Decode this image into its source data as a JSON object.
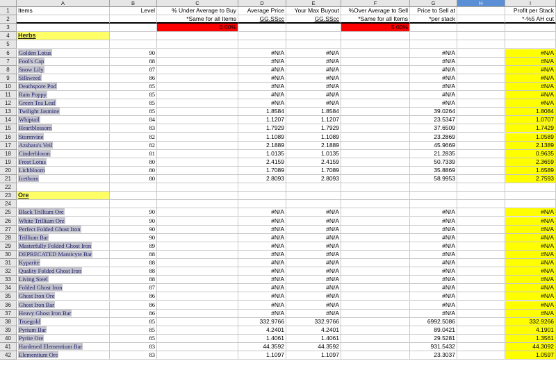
{
  "columns": [
    "A",
    "B",
    "C",
    "D",
    "E",
    "F",
    "G",
    "H",
    "I"
  ],
  "selected_column": "H",
  "header_row1": [
    "Items",
    "Level",
    "% Under Average to Buy",
    "Average Price",
    "Your Max Buyout",
    "%Over Average to Sell",
    "Price to Sell at",
    "",
    "Profit per Stack"
  ],
  "header_row2": [
    "",
    "",
    "*Same for all Items",
    "GG.SScc",
    "GG.SScc",
    "*Same for all Items",
    "*per stack",
    "",
    "*-%5 AH cut"
  ],
  "under_percent": "0.00%",
  "over_percent": "5.00%",
  "herbs_label": "Herbs",
  "ore_label": "Ore",
  "herbs": [
    {
      "name": "Golden Lotus",
      "level": "90",
      "avg": "#N/A",
      "max": "#N/A",
      "sell": "#N/A",
      "profit": "#N/A"
    },
    {
      "name": "Fool's Cap",
      "level": "88",
      "avg": "#N/A",
      "max": "#N/A",
      "sell": "#N/A",
      "profit": "#N/A"
    },
    {
      "name": "Snow Lily",
      "level": "87",
      "avg": "#N/A",
      "max": "#N/A",
      "sell": "#N/A",
      "profit": "#N/A"
    },
    {
      "name": "Silkweed",
      "level": "86",
      "avg": "#N/A",
      "max": "#N/A",
      "sell": "#N/A",
      "profit": "#N/A"
    },
    {
      "name": "Deathspore Pod",
      "level": "85",
      "avg": "#N/A",
      "max": "#N/A",
      "sell": "#N/A",
      "profit": "#N/A"
    },
    {
      "name": "Rain Poppy",
      "level": "85",
      "avg": "#N/A",
      "max": "#N/A",
      "sell": "#N/A",
      "profit": "#N/A"
    },
    {
      "name": "Green Tea Leaf",
      "level": "85",
      "avg": "#N/A",
      "max": "#N/A",
      "sell": "#N/A",
      "profit": "#N/A"
    },
    {
      "name": "Twilight Jasmine",
      "level": "85",
      "avg": "1.8584",
      "max": "1.8584",
      "sell": "39.0264",
      "profit": "1.8084"
    },
    {
      "name": "Whiptail",
      "level": "84",
      "avg": "1.1207",
      "max": "1.1207",
      "sell": "23.5347",
      "profit": "1.0707"
    },
    {
      "name": "Heartblossom",
      "level": "83",
      "avg": "1.7929",
      "max": "1.7929",
      "sell": "37.6509",
      "profit": "1.7429"
    },
    {
      "name": "Stormvine",
      "level": "82",
      "avg": "1.1089",
      "max": "1.1089",
      "sell": "23.2869",
      "profit": "1.0589"
    },
    {
      "name": "Azshara's Veil",
      "level": "82",
      "avg": "2.1889",
      "max": "2.1889",
      "sell": "45.9669",
      "profit": "2.1389"
    },
    {
      "name": "Cinderbloom",
      "level": "81",
      "avg": "1.0135",
      "max": "1.0135",
      "sell": "21.2835",
      "profit": "0.9635"
    },
    {
      "name": "Frost Lotus",
      "level": "80",
      "avg": "2.4159",
      "max": "2.4159",
      "sell": "50.7339",
      "profit": "2.3659"
    },
    {
      "name": "Lichbloom",
      "level": "80",
      "avg": "1.7089",
      "max": "1.7089",
      "sell": "35.8869",
      "profit": "1.6589"
    },
    {
      "name": "Icethorn",
      "level": "80",
      "avg": "2.8093",
      "max": "2.8093",
      "sell": "58.9953",
      "profit": "2.7593"
    }
  ],
  "ore": [
    {
      "name": "Black Trillium Ore",
      "level": "90",
      "avg": "#N/A",
      "max": "#N/A",
      "sell": "#N/A",
      "profit": "#N/A"
    },
    {
      "name": "White Trillium Ore",
      "level": "90",
      "avg": "#N/A",
      "max": "#N/A",
      "sell": "#N/A",
      "profit": "#N/A"
    },
    {
      "name": "Perfect Folded Ghost Iron",
      "level": "90",
      "avg": "#N/A",
      "max": "#N/A",
      "sell": "#N/A",
      "profit": "#N/A"
    },
    {
      "name": "Trillium Bar",
      "level": "90",
      "avg": "#N/A",
      "max": "#N/A",
      "sell": "#N/A",
      "profit": "#N/A"
    },
    {
      "name": "Masterfully Folded Ghost Iron",
      "level": "89",
      "avg": "#N/A",
      "max": "#N/A",
      "sell": "#N/A",
      "profit": "#N/A"
    },
    {
      "name": "DEPRECATED Manticyte Bar",
      "level": "88",
      "avg": "#N/A",
      "max": "#N/A",
      "sell": "#N/A",
      "profit": "#N/A"
    },
    {
      "name": "Kyparite",
      "level": "88",
      "avg": "#N/A",
      "max": "#N/A",
      "sell": "#N/A",
      "profit": "#N/A"
    },
    {
      "name": "Quality Folded Ghost Iron",
      "level": "88",
      "avg": "#N/A",
      "max": "#N/A",
      "sell": "#N/A",
      "profit": "#N/A"
    },
    {
      "name": "Living Steel",
      "level": "88",
      "avg": "#N/A",
      "max": "#N/A",
      "sell": "#N/A",
      "profit": "#N/A"
    },
    {
      "name": "Folded Ghost Iron",
      "level": "87",
      "avg": "#N/A",
      "max": "#N/A",
      "sell": "#N/A",
      "profit": "#N/A"
    },
    {
      "name": "Ghost Iron Ore",
      "level": "86",
      "avg": "#N/A",
      "max": "#N/A",
      "sell": "#N/A",
      "profit": "#N/A"
    },
    {
      "name": "Ghost Iron Bar",
      "level": "86",
      "avg": "#N/A",
      "max": "#N/A",
      "sell": "#N/A",
      "profit": "#N/A"
    },
    {
      "name": "Heavy Ghost Iron Bar",
      "level": "86",
      "avg": "#N/A",
      "max": "#N/A",
      "sell": "#N/A",
      "profit": "#N/A"
    },
    {
      "name": "Truegold",
      "level": "85",
      "avg": "332.9766",
      "max": "332.9766",
      "sell": "6992.5086",
      "profit": "332.9266"
    },
    {
      "name": "Pyrium Bar",
      "level": "85",
      "avg": "4.2401",
      "max": "4.2401",
      "sell": "89.0421",
      "profit": "4.1901"
    },
    {
      "name": "Pyrite Ore",
      "level": "85",
      "avg": "1.4061",
      "max": "1.4061",
      "sell": "29.5281",
      "profit": "1.3561"
    },
    {
      "name": "Hardened Elementium Bar",
      "level": "83",
      "avg": "44.3592",
      "max": "44.3592",
      "sell": "931.5432",
      "profit": "44.3092"
    },
    {
      "name": "Elementium Ore",
      "level": "83",
      "avg": "1.1097",
      "max": "1.1097",
      "sell": "23.3037",
      "profit": "1.0597"
    }
  ],
  "colors": {
    "highlight": "#ffff00",
    "alert": "#ff0000",
    "section": "#ffff66",
    "selected_header": "#5a8fd6"
  }
}
